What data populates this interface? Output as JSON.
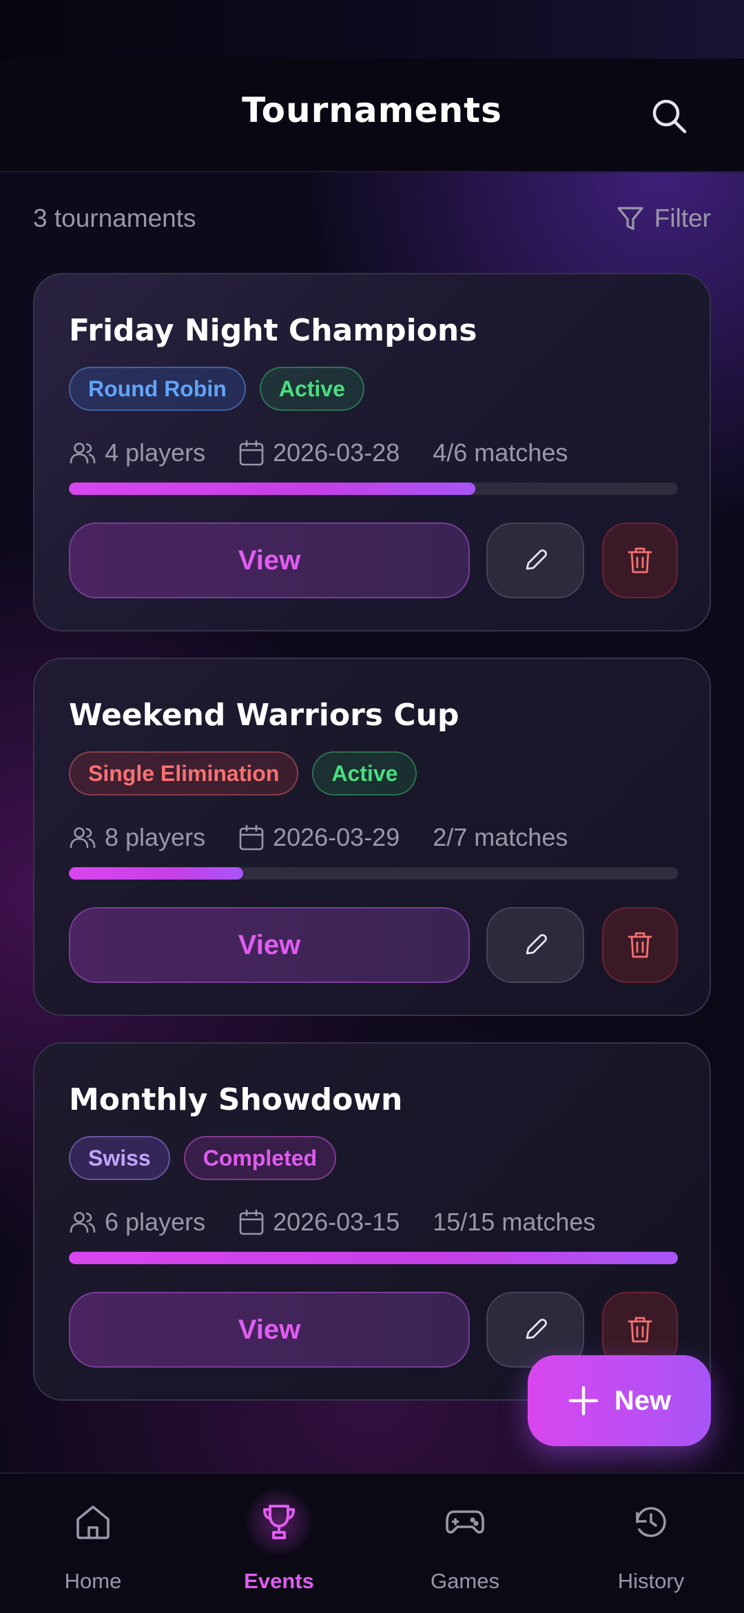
{
  "header": {
    "title": "Tournaments"
  },
  "summary": {
    "count_text": "3 tournaments",
    "filter_label": "Filter"
  },
  "tournaments": [
    {
      "name": "Friday Night Champions",
      "format": "Round Robin",
      "status": "Active",
      "players": "4 players",
      "date": "2026-03-28",
      "matches": "4/6 matches",
      "progress": 0.667,
      "view_label": "View"
    },
    {
      "name": "Weekend Warriors Cup",
      "format": "Single Elimination",
      "status": "Active",
      "players": "8 players",
      "date": "2026-03-29",
      "matches": "2/7 matches",
      "progress": 0.286,
      "view_label": "View"
    },
    {
      "name": "Monthly Showdown",
      "format": "Swiss",
      "status": "Completed",
      "players": "6 players",
      "date": "2026-03-15",
      "matches": "15/15 matches",
      "progress": 1.0,
      "view_label": "View"
    }
  ],
  "fab": {
    "label": "New"
  },
  "nav": {
    "items": [
      {
        "label": "Home",
        "icon": "home-icon"
      },
      {
        "label": "Events",
        "icon": "trophy-icon",
        "active": true
      },
      {
        "label": "Games",
        "icon": "gamepad-icon"
      },
      {
        "label": "History",
        "icon": "history-icon"
      }
    ]
  },
  "colors": {
    "accent": "#d946ef",
    "accent_secondary": "#a855f7",
    "background": "#0b0916",
    "muted_text": "#9a98a8",
    "status_active": "#4ade80",
    "format_round_robin": "#60a5fa",
    "format_single_elimination": "#f87171",
    "format_swiss": "#c4a3fc",
    "status_completed": "#e05cf0"
  }
}
